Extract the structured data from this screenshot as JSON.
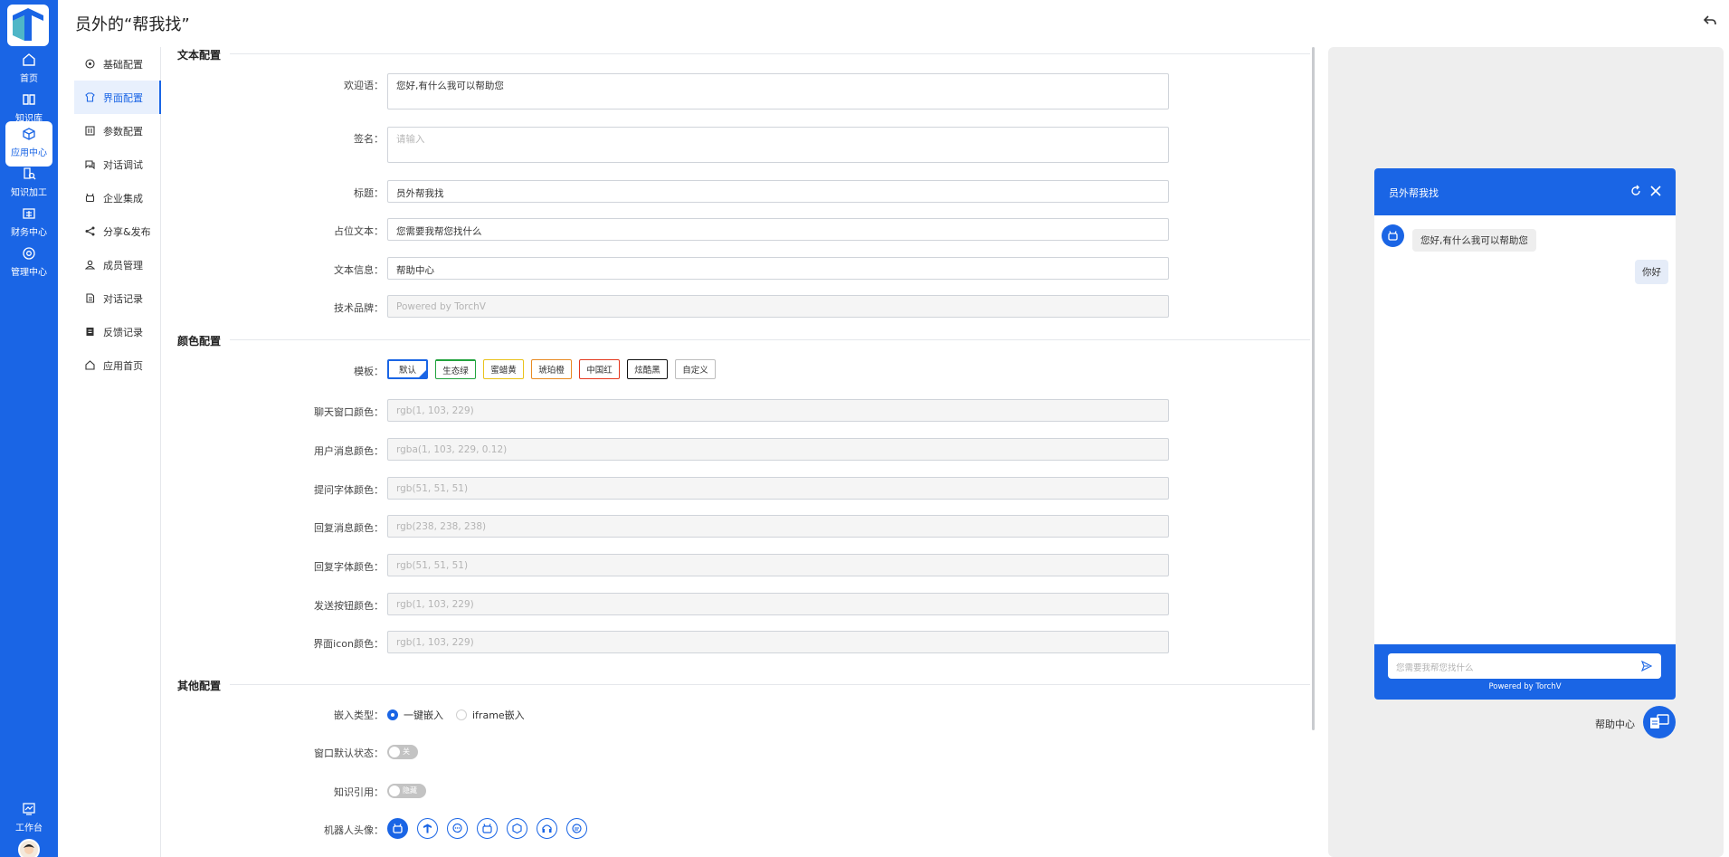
{
  "header": {
    "title": "员外的“帮我找”"
  },
  "rail": [
    {
      "label": "首页",
      "icon": "home-icon"
    },
    {
      "label": "知识库",
      "icon": "book-icon"
    },
    {
      "label": "应用中心",
      "icon": "cube-icon",
      "active": true
    },
    {
      "label": "知识加工",
      "icon": "doc-search-icon"
    },
    {
      "label": "财务中心",
      "icon": "finance-icon"
    },
    {
      "label": "管理中心",
      "icon": "settings-icon"
    },
    {
      "label": "工作台",
      "icon": "workbench-icon"
    }
  ],
  "subnav": [
    "基础配置",
    "界面配置",
    "参数配置",
    "对话调试",
    "企业集成",
    "分享&发布",
    "成员管理",
    "对话记录",
    "反馈记录",
    "应用首页"
  ],
  "sections": {
    "text": "文本配置",
    "color": "颜色配置",
    "other": "其他配置"
  },
  "text_config": {
    "welcome_label": "欢迎语：",
    "welcome_value": "您好,有什么我可以帮助您",
    "signature_label": "签名：",
    "signature_placeholder": "请输入",
    "title_label": "标题：",
    "title_value": "员外帮我找",
    "placeholder_label": "占位文本：",
    "placeholder_value": "您需要我帮您找什么",
    "info_label": "文本信息：",
    "info_value": "帮助中心",
    "brand_label": "技术品牌：",
    "brand_value": "Powered by TorchV"
  },
  "color_config": {
    "template_label": "模板：",
    "templates": [
      "默认",
      "生态绿",
      "蜜蜡黄",
      "琥珀橙",
      "中国红",
      "炫酷黑",
      "自定义"
    ],
    "template_colors": [
      "#1a65e5",
      "#22a33e",
      "#e9c21b",
      "#e88a22",
      "#e4381e",
      "#111111",
      "#bdbdbd"
    ],
    "fields": [
      {
        "label": "聊天窗口颜色：",
        "value": "rgb(1, 103, 229)"
      },
      {
        "label": "用户消息颜色：",
        "value": "rgba(1, 103, 229, 0.12)"
      },
      {
        "label": "提问字体颜色：",
        "value": "rgb(51, 51, 51)"
      },
      {
        "label": "回复消息颜色：",
        "value": "rgb(238, 238, 238)"
      },
      {
        "label": "回复字体颜色：",
        "value": "rgb(51, 51, 51)"
      },
      {
        "label": "发送按钮颜色：",
        "value": "rgb(1, 103, 229)"
      },
      {
        "label": "界面icon颜色：",
        "value": "rgb(1, 103, 229)"
      }
    ]
  },
  "other_config": {
    "embed_label": "嵌入类型：",
    "embed_opt1": "一键嵌入",
    "embed_opt2": "iframe嵌入",
    "window_label": "窗口默认状态：",
    "window_toggle": "关",
    "knowledge_label": "知识引用：",
    "knowledge_toggle": "隐藏",
    "avatar_label": "机器人头像："
  },
  "preview": {
    "chat_title": "员外帮我找",
    "bot_message": "您好,有什么我可以帮助您",
    "user_message": "你好",
    "input_placeholder": "您需要我帮您找什么",
    "powered": "Powered by TorchV",
    "help_label": "帮助中心"
  }
}
